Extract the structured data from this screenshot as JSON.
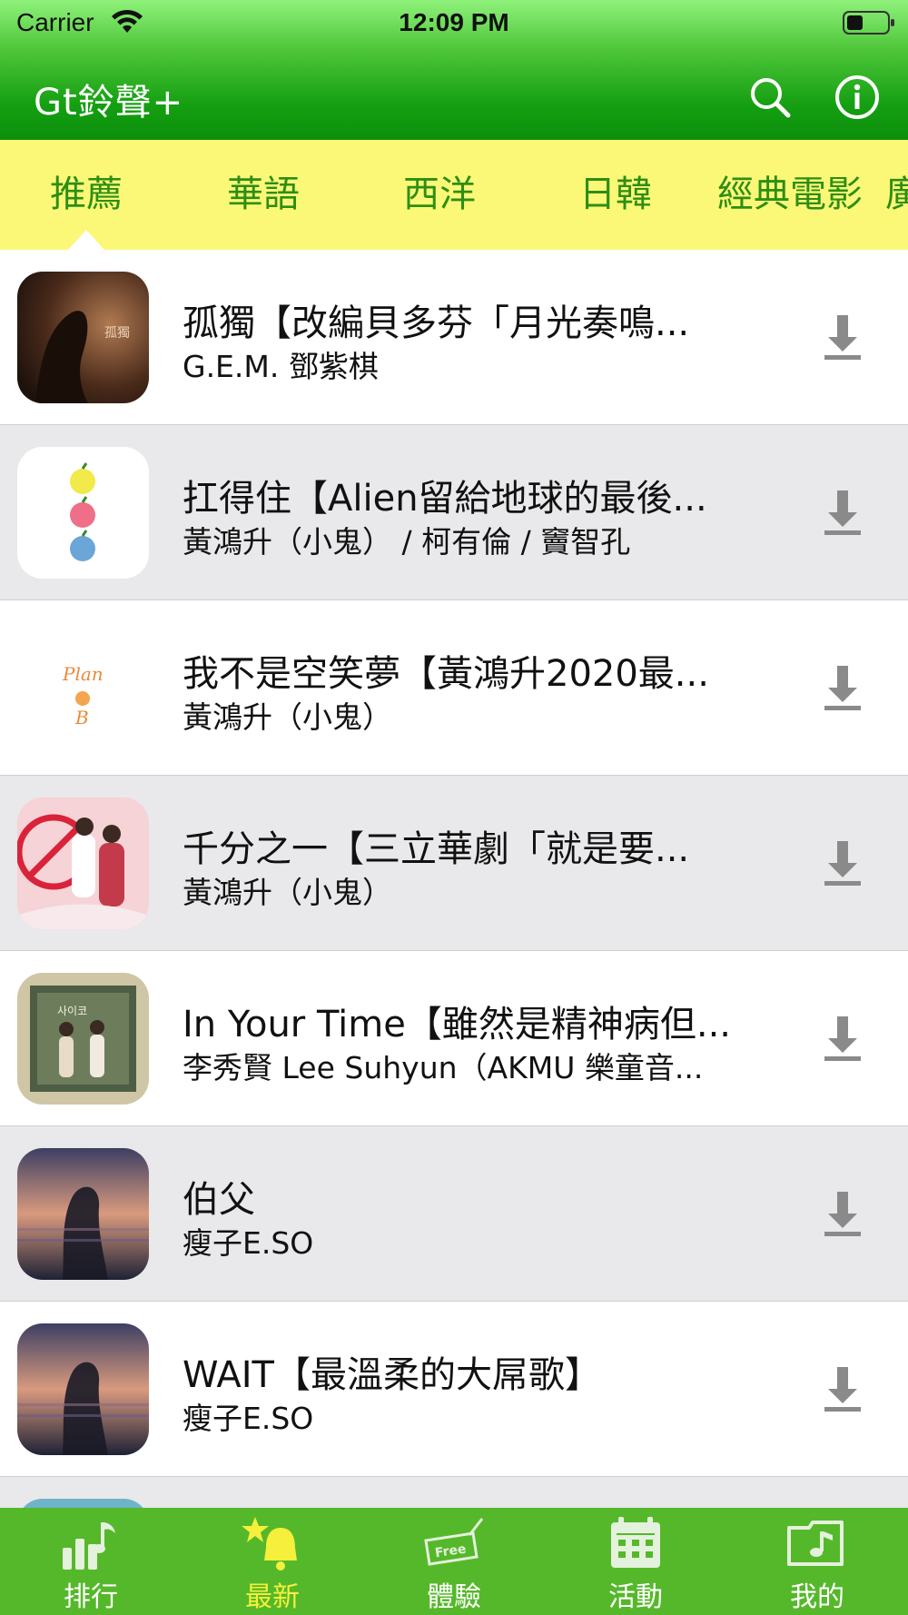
{
  "status_bar": {
    "carrier": "Carrier",
    "time": "12:09 PM"
  },
  "nav": {
    "title": "Gt鈴聲+",
    "search_icon": "search-icon",
    "info_icon": "info-icon"
  },
  "category_tabs": [
    {
      "label": "推薦",
      "selected": true
    },
    {
      "label": "華語"
    },
    {
      "label": "西洋"
    },
    {
      "label": "日韓"
    },
    {
      "label": "經典電影"
    },
    {
      "label": "廣"
    }
  ],
  "songs": [
    {
      "title": "孤獨【改編貝多芬「月光奏鳴...",
      "artist": "G.E.M. 鄧紫棋"
    },
    {
      "title": "扛得住【Alien留給地球的最後...",
      "artist": "黃鴻升（小鬼） / 柯有倫 / 竇智孔"
    },
    {
      "title": "我不是空笑夢【黃鴻升2020最...",
      "artist": "黃鴻升（小鬼）"
    },
    {
      "title": "千分之一【三立華劇「就是要...",
      "artist": "黃鴻升（小鬼）"
    },
    {
      "title": "In Your Time【雖然是精神病但...",
      "artist": "李秀賢 Lee Suhyun（AKMU 樂童音..."
    },
    {
      "title": "伯父",
      "artist": "瘦子E.SO"
    },
    {
      "title": "WAIT【最溫柔的大屌歌】",
      "artist": "瘦子E.SO"
    }
  ],
  "bottom_tabs": [
    {
      "label": "排行",
      "icon": "chart-music-icon"
    },
    {
      "label": "最新",
      "icon": "star-bell-icon",
      "active": true
    },
    {
      "label": "體驗",
      "icon": "free-ticket-icon",
      "badge": "Free"
    },
    {
      "label": "活動",
      "icon": "calendar-icon"
    },
    {
      "label": "我的",
      "icon": "music-folder-icon"
    }
  ],
  "colors": {
    "header_green": "#159f12",
    "tab_bar_yellow": "#fbf878",
    "tab_text_green": "#2d8e14",
    "bottom_bar_green": "#55b82a",
    "active_tab_yellow": "#f6ef3b",
    "alt_row_gray": "#e9e8ea"
  }
}
